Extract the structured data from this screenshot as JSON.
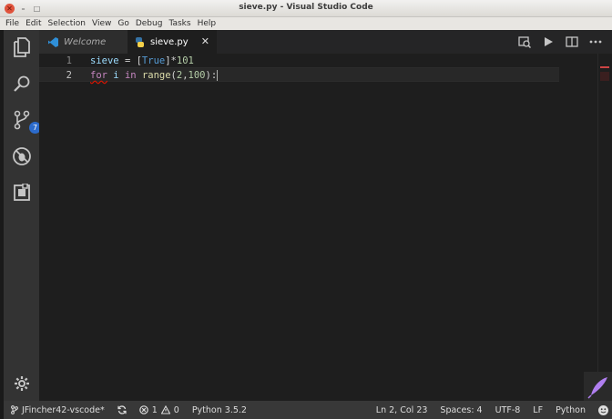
{
  "window": {
    "title": "sieve.py - Visual Studio Code",
    "close_glyph": "✕",
    "min_glyph": "–",
    "max_glyph": "□"
  },
  "menu": [
    "File",
    "Edit",
    "Selection",
    "View",
    "Go",
    "Debug",
    "Tasks",
    "Help"
  ],
  "activity": {
    "items": [
      "explorer-icon",
      "search-icon",
      "source-control-icon",
      "debug-icon",
      "extensions-icon"
    ],
    "source_control_badge": "7",
    "settings": "gear-icon"
  },
  "tabs": [
    {
      "label": "Welcome",
      "icon": "vscode-logo-icon",
      "active": false
    },
    {
      "label": "sieve.py",
      "icon": "python-file-icon",
      "active": true,
      "close": "✕"
    }
  ],
  "editor": {
    "lines": [
      {
        "number": "1",
        "text": "sieve = [True]*101"
      },
      {
        "number": "2",
        "text": "for i in range(2,100):"
      }
    ]
  },
  "statusbar": {
    "branch": "JFincher42-vscode*",
    "errors": "1",
    "warnings": "0",
    "interpreter": "Python 3.5.2",
    "position": "Ln 2, Col 23",
    "spaces": "Spaces: 4",
    "encoding": "UTF-8",
    "eol": "LF",
    "language": "Python"
  },
  "colors": {
    "activity_bar": "#333333",
    "editor_bg": "#1e1e1e",
    "badge": "#2c6bcc",
    "status_bar": "#383838"
  }
}
